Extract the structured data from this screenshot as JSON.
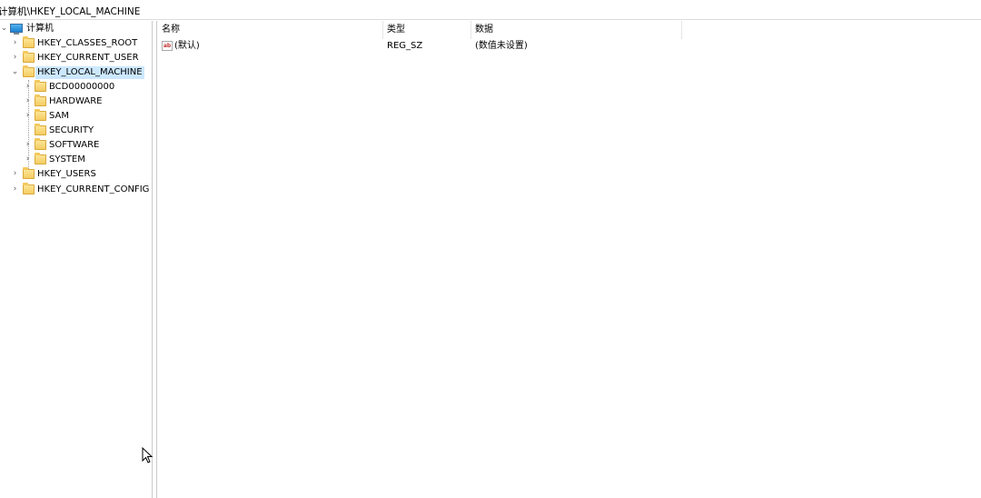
{
  "address": {
    "path": "计算机\\HKEY_LOCAL_MACHINE"
  },
  "tree": {
    "root": {
      "label": "计算机",
      "icon": "computer-icon"
    },
    "hives": [
      {
        "label": "HKEY_CLASSES_ROOT"
      },
      {
        "label": "HKEY_CURRENT_USER"
      },
      {
        "label": "HKEY_LOCAL_MACHINE",
        "expanded": true,
        "selected": true
      },
      {
        "label": "HKEY_USERS"
      },
      {
        "label": "HKEY_CURRENT_CONFIG"
      }
    ],
    "children": [
      {
        "label": "BCD00000000",
        "has_children": true
      },
      {
        "label": "HARDWARE",
        "has_children": true
      },
      {
        "label": "SAM",
        "has_children": true
      },
      {
        "label": "SECURITY",
        "has_children": false
      },
      {
        "label": "SOFTWARE",
        "has_children": true
      },
      {
        "label": "SYSTEM",
        "has_children": true
      }
    ]
  },
  "list": {
    "columns": [
      "名称",
      "类型",
      "数据"
    ],
    "rows": [
      {
        "name": "(默认)",
        "type": "REG_SZ",
        "data": "(数值未设置)",
        "icon": "string-value-icon",
        "icon_text": "ab"
      }
    ]
  },
  "colors": {
    "selection": "#cce8ff",
    "folder": "#f4c95d",
    "divider": "#c9c9c9"
  }
}
